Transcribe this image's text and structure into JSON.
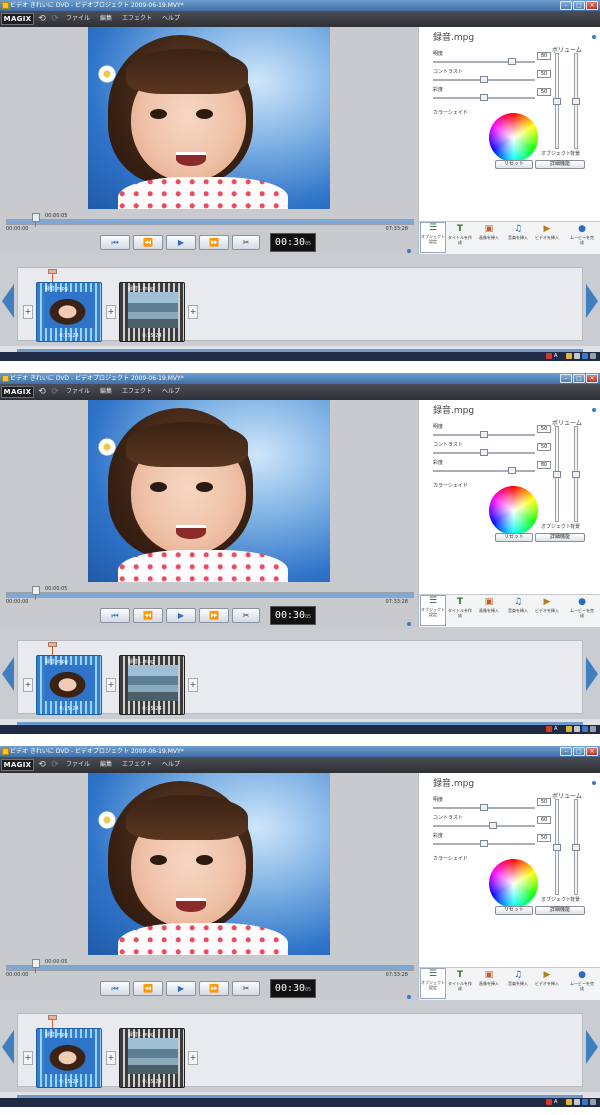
{
  "window": {
    "title": "ビデオ きれいに DVD - ビデオプロジェクト 2009-06-19.MVY*"
  },
  "app": {
    "logo": "MAGIX"
  },
  "menu": [
    "ファイル",
    "編集",
    "エフェクト",
    "ヘルプ"
  ],
  "colors": {
    "accent": "#3c78c8",
    "titlebar": "#3f6ea6",
    "menubar": "#2e3035",
    "clip_selected": "#2f7fcd"
  },
  "icons": {
    "undo": "undo-icon",
    "redo": "redo-icon",
    "cut": "scissors-icon"
  },
  "playback": {
    "position": "00:00:05",
    "start": "00:00:00",
    "end": "07:33:28",
    "timecode": "00:30",
    "frames": "05"
  },
  "toolbar": [
    {
      "label": "オブジェクト設定",
      "icon": "sliders-icon"
    },
    {
      "label": "タイトルを作成",
      "icon": "title-T-icon"
    },
    {
      "label": "画像を挿入",
      "icon": "image-icon"
    },
    {
      "label": "音楽を挿入",
      "icon": "music-icon"
    },
    {
      "label": "ビデオを挿入",
      "icon": "video-icon"
    },
    {
      "label": "ムービーを完成",
      "icon": "globe-icon"
    }
  ],
  "clips": [
    {
      "name": "録音.mpg",
      "duration": "0:15:24"
    },
    {
      "name": "録音1.mpg",
      "duration": "0:15:24"
    }
  ],
  "frames": [
    {
      "effects": {
        "title": "録音.mpg",
        "brightness_label": "明度",
        "brightness": "80",
        "contrast_label": "コントラスト",
        "contrast": "50",
        "saturation_label": "彩度",
        "saturation": "50",
        "shade_label": "カラーシェイド",
        "volume_label": "ボリューム",
        "object_label": "オブジェクト",
        "background_label": "背景",
        "reset_label": "リセット",
        "detail_label": "詳細機能"
      }
    },
    {
      "effects": {
        "title": "録音.mpg",
        "brightness_label": "明度",
        "brightness": "50",
        "contrast_label": "コントラスト",
        "contrast": "50",
        "saturation_label": "彩度",
        "saturation": "80",
        "shade_label": "カラーシェイド",
        "volume_label": "ボリューム",
        "object_label": "オブジェクト",
        "background_label": "背景",
        "reset_label": "リセット",
        "detail_label": "詳細機能"
      }
    },
    {
      "effects": {
        "title": "録音.mpg",
        "brightness_label": "明度",
        "brightness": "50",
        "contrast_label": "コントラスト",
        "contrast": "60",
        "saturation_label": "彩度",
        "saturation": "50",
        "shade_label": "カラーシェイド",
        "volume_label": "ボリューム",
        "object_label": "オブジェクト",
        "background_label": "背景",
        "reset_label": "リセット",
        "detail_label": "詳細機能"
      }
    }
  ]
}
